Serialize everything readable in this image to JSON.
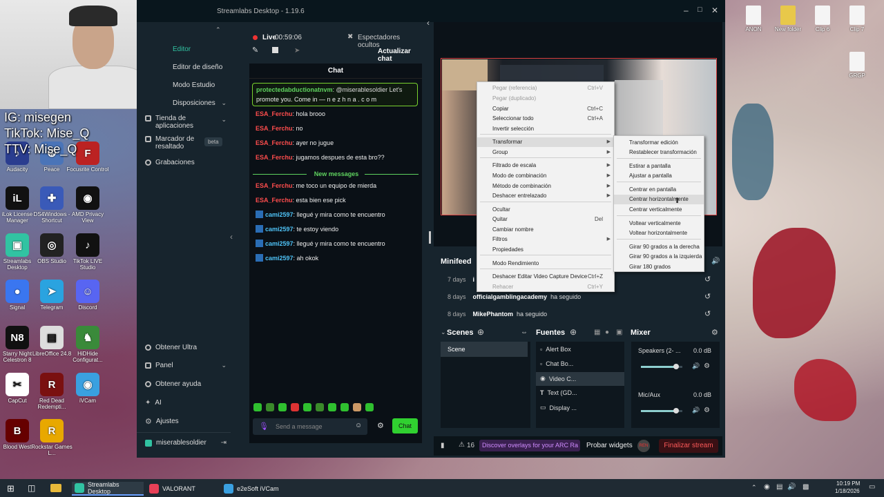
{
  "overlay": {
    "ig": "IG: misegen",
    "tiktok": "TikTok: Mise_Q",
    "ttv": "TTV: Mise_Q"
  },
  "desktop_left": [
    {
      "label": "Audacity",
      "icon": "audacity-icon",
      "color": "#2a3d8f",
      "glyph": "♪"
    },
    {
      "label": "Peace",
      "icon": "peace-icon",
      "color": "#4a74b8",
      "glyph": "☮"
    },
    {
      "label": "Focusrite Control",
      "icon": "focusrite-icon",
      "color": "#b22",
      "glyph": "F"
    },
    {
      "label": "iLok License Manager",
      "icon": "ilok-icon",
      "color": "#111",
      "glyph": "iL"
    },
    {
      "label": "DS4Windows - Shortcut",
      "icon": "ds4windows-icon",
      "color": "#3a5ab8",
      "glyph": "✚"
    },
    {
      "label": "AMD Privacy View",
      "icon": "amd-icon",
      "color": "#111",
      "glyph": "◉"
    },
    {
      "label": "Streamlabs Desktop",
      "icon": "streamlabs-icon",
      "color": "#31c3a2",
      "glyph": "▣"
    },
    {
      "label": "OBS Studio",
      "icon": "obs-icon",
      "color": "#222",
      "glyph": "◎"
    },
    {
      "label": "TikTok LIVE Studio",
      "icon": "tiktok-icon",
      "color": "#111",
      "glyph": "♪"
    },
    {
      "label": "Signal",
      "icon": "signal-icon",
      "color": "#3a76f0",
      "glyph": "●"
    },
    {
      "label": "Telegram",
      "icon": "telegram-icon",
      "color": "#2aa3e0",
      "glyph": "➤"
    },
    {
      "label": "Discord",
      "icon": "discord-icon",
      "color": "#5865f2",
      "glyph": "☺"
    },
    {
      "label": "Starry Night Celestron 8",
      "icon": "starrynight-icon",
      "color": "#111",
      "glyph": "N8"
    },
    {
      "label": "LibreOffice 24.8",
      "icon": "libreoffice-icon",
      "color": "#ddd",
      "glyph": "▤"
    },
    {
      "label": "HiDHide Configurat...",
      "icon": "hidhide-icon",
      "color": "#3a8a3a",
      "glyph": "♞"
    },
    {
      "label": "CapCut",
      "icon": "capcut-icon",
      "color": "#fff",
      "glyph": "✂"
    },
    {
      "label": "Red Dead Redempti...",
      "icon": "rdr-icon",
      "color": "#7a1010",
      "glyph": "R"
    },
    {
      "label": "iVCam",
      "icon": "ivcam-icon",
      "color": "#3aa0e0",
      "glyph": "◉"
    },
    {
      "label": "Blood West",
      "icon": "bloodwest-icon",
      "color": "#600",
      "glyph": "B"
    },
    {
      "label": "Rockstar Games L...",
      "icon": "rockstar-icon",
      "color": "#e8a800",
      "glyph": "R"
    }
  ],
  "desktop_right": [
    {
      "label": "ANON",
      "icon": "file-icon"
    },
    {
      "label": "New folder",
      "icon": "folder-icon"
    },
    {
      "label": "Clip 6",
      "icon": "file-icon"
    },
    {
      "label": "Clip 7",
      "icon": "file-icon"
    },
    {
      "label": "GRGP",
      "icon": "file-icon"
    }
  ],
  "app": {
    "title": "Streamlabs Desktop - 1.19.6"
  },
  "sidebar": {
    "items": [
      {
        "label": "Editor"
      },
      {
        "label": "Editor de diseño"
      },
      {
        "label": "Modo Estudio"
      },
      {
        "label": "Disposiciones"
      },
      {
        "label": "Tienda de aplicaciones"
      },
      {
        "label": "Marcador de resaltado"
      },
      {
        "label": "Grabaciones"
      }
    ],
    "beta": "beta",
    "bottom": [
      {
        "label": "Obtener Ultra"
      },
      {
        "label": "Panel"
      },
      {
        "label": "Obtener ayuda"
      },
      {
        "label": "AI"
      },
      {
        "label": "Ajustes"
      }
    ],
    "user": "miserablesoldier"
  },
  "chat": {
    "live_label": "Live",
    "live_time": "00:59:06",
    "viewers_hidden": "Espectadores ocultos",
    "refresh": "Actualizar chat",
    "header": "Chat",
    "pinned_user": "protectedabductionatnvm",
    "pinned_text": ": @miserablesoldier Let's",
    "pinned_text2": "promote you. Come in — n e z h n a . c o m",
    "new_messages": "New messages",
    "messages": [
      {
        "user": "ESA_Ferchu",
        "text": ": hola brooo"
      },
      {
        "user": "ESA_Ferchu",
        "text": ": no"
      },
      {
        "user": "ESA_Ferchu",
        "text": ": ayer no jugue"
      },
      {
        "user": "ESA_Ferchu",
        "text": ": jugamos despues de esta bro??"
      }
    ],
    "messages2": [
      {
        "user": "ESA_Ferchu",
        "text": ": me toco un equipo de mierda",
        "kind": "red"
      },
      {
        "user": "ESA_Ferchu",
        "text": ": esta bien ese pick",
        "kind": "red"
      },
      {
        "user": "cami2597",
        "text": ": llegué y mira como te encuentro",
        "kind": "blue"
      },
      {
        "user": "cami2597",
        "text": ": te estoy viendo",
        "kind": "blue"
      },
      {
        "user": "cami2597",
        "text": ": llegué y mira como te encuentro",
        "kind": "blue"
      },
      {
        "user": "cami2597",
        "text": ": ah okok",
        "kind": "blue"
      }
    ],
    "input_placeholder": "Send a message",
    "send": "Chat"
  },
  "minifeed": {
    "title": "Minifeed",
    "rows": [
      {
        "time": "7 days",
        "user": "i",
        "action": ""
      },
      {
        "time": "8 days",
        "user": "officialgamblingacademy",
        "action": "ha seguido"
      },
      {
        "time": "8 days",
        "user": "MikePhantom",
        "action": "ha seguido"
      }
    ]
  },
  "scenes": {
    "title": "Scenes",
    "items": [
      "Scene"
    ]
  },
  "sources": {
    "title": "Fuentes",
    "items": [
      "Alert Box",
      "Chat Bo...",
      "Video C...",
      "Text (GD...",
      "Display ..."
    ]
  },
  "mixer": {
    "title": "Mixer",
    "channels": [
      {
        "name": "Speakers (2- ...",
        "db": "0.0 dB",
        "level": 0.85
      },
      {
        "name": "Mic/Aux",
        "db": "0.0 dB",
        "level": 0.85
      }
    ]
  },
  "statusbar": {
    "alerts": "16",
    "promo": "Discover overlays for your ARC Ra",
    "widgets": "Probar widgets",
    "avatar": "REN",
    "end": "Finalizar stream"
  },
  "context_menu": {
    "items": [
      {
        "label": "Pegar (referencia)",
        "shortcut": "Ctrl+V",
        "disabled": true
      },
      {
        "label": "Pegar (duplicado)",
        "shortcut": "",
        "disabled": true
      },
      {
        "label": "Copiar",
        "shortcut": "Ctrl+C"
      },
      {
        "label": "Seleccionar todo",
        "shortcut": "Ctrl+A"
      },
      {
        "label": "Invertir selección",
        "shortcut": ""
      },
      {
        "label": "Transformar",
        "submenu": true
      },
      {
        "label": "Group",
        "submenu": true
      },
      {
        "label": "Filtrado de escala",
        "submenu": true
      },
      {
        "label": "Modo de combinación",
        "submenu": true
      },
      {
        "label": "Método de combinación",
        "submenu": true
      },
      {
        "label": "Deshacer entrelazado",
        "submenu": true
      },
      {
        "label": "Ocultar",
        "shortcut": ""
      },
      {
        "label": "Quitar",
        "shortcut": "Del"
      },
      {
        "label": "Cambiar nombre",
        "shortcut": ""
      },
      {
        "label": "Filtros",
        "submenu": true
      },
      {
        "label": "Propiedades",
        "shortcut": ""
      },
      {
        "label": "Modo Rendimiento",
        "shortcut": ""
      },
      {
        "label": "Deshacer Editar Video Capture Device",
        "shortcut": "Ctrl+Z"
      },
      {
        "label": "Rehacer",
        "shortcut": "Ctrl+Y",
        "disabled": true
      }
    ]
  },
  "submenu": {
    "items": [
      "Transformar edición",
      "Restablecer transformación",
      "Estirar a pantalla",
      "Ajustar a pantalla",
      "Centrar en pantalla",
      "Centrar horizontalmente",
      "Centrar verticalmente",
      "Voltear verticalmente",
      "Voltear horizontalmente",
      "Girar 90 grados a la derecha",
      "Girar 90 grados a la izquierda",
      "Girar 180 grados"
    ]
  },
  "taskbar": {
    "items": [
      {
        "label": "Streamlabs Desktop",
        "color": "#31c3a2"
      },
      {
        "label": "VALORANT",
        "color": "#e84057"
      },
      {
        "label": "e2eSoft iVCam",
        "color": "#3aa0e0"
      }
    ],
    "time": "10:19 PM",
    "date": "1/18/2026"
  }
}
